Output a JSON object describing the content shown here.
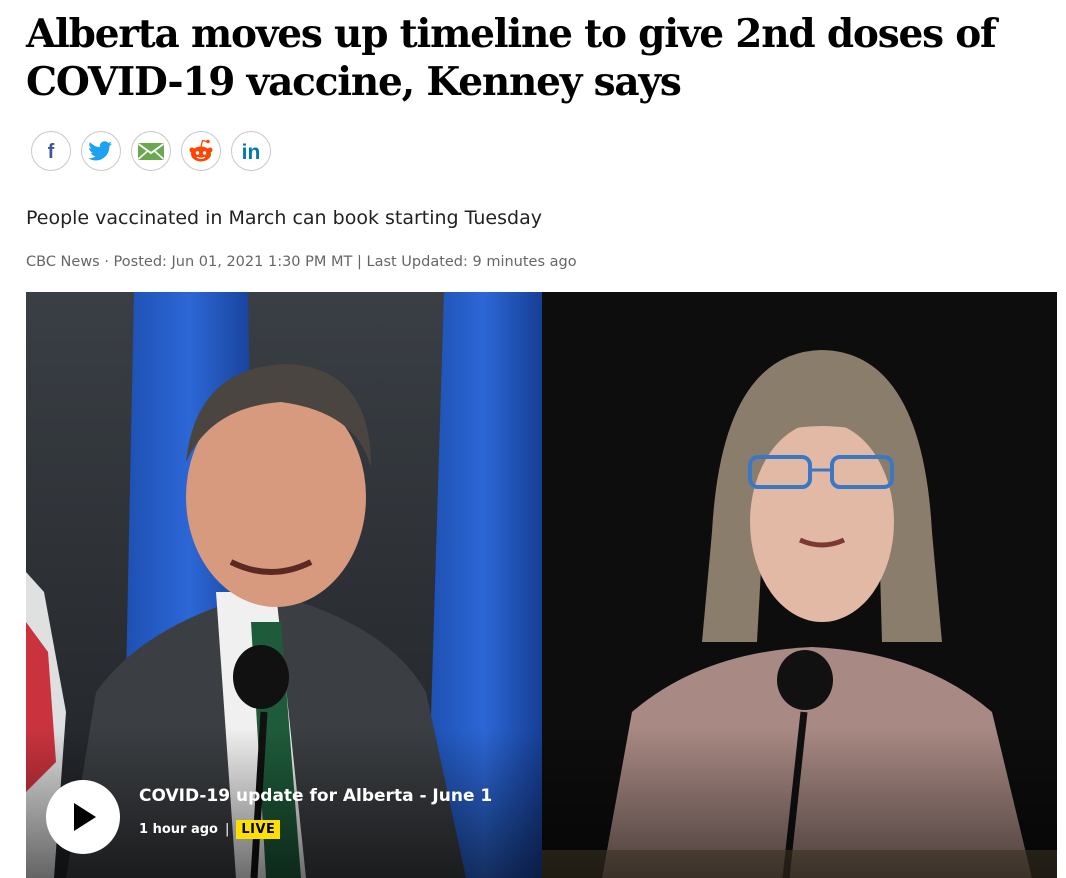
{
  "article": {
    "headline": "Alberta moves up timeline to give 2nd doses of COVID-19 vaccine, Kenney says",
    "deck": "People vaccinated in March can book starting Tuesday",
    "byline": {
      "source": "CBC News",
      "posted": "· Posted: Jun 01, 2021 1:30 PM MT",
      "divider": "|",
      "updated": "Last Updated: 9 minutes ago"
    }
  },
  "share": {
    "buttons": [
      {
        "icon": "facebook-icon",
        "color": "#3b5998"
      },
      {
        "icon": "twitter-icon",
        "color": "#1da1f2"
      },
      {
        "icon": "email-icon",
        "color": "#5a9e47"
      },
      {
        "icon": "reddit-icon",
        "color": "#ff4500"
      },
      {
        "icon": "linkedin-icon",
        "color": "#0077b5"
      }
    ]
  },
  "video": {
    "title": "COVID-19 update for Alberta - June 1",
    "time_ago": "1 hour ago",
    "divider": "|",
    "live_label": "LIVE",
    "live_color": "#fddf00"
  }
}
